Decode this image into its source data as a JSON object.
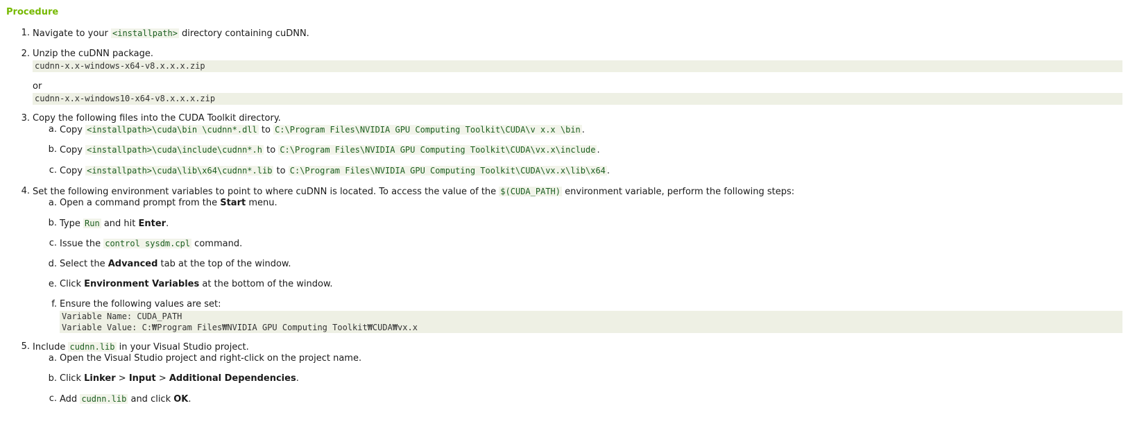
{
  "title": "Procedure",
  "steps": {
    "s1": {
      "num": "1.",
      "pre": "Navigate to your ",
      "code": "<installpath>",
      "post": " directory containing cuDNN."
    },
    "s2": {
      "num": "2.",
      "text": "Unzip the cuDNN package.",
      "block1": "cudnn-x.x-windows-x64-v8.x.x.x.zip",
      "or": "or",
      "block2": "cudnn-x.x-windows10-x64-v8.x.x.x.zip"
    },
    "s3": {
      "num": "3.",
      "text": "Copy the following files into the CUDA Toolkit directory.",
      "a": {
        "num": "a.",
        "pre": "Copy ",
        "code1": "<installpath>\\cuda\\bin \\cudnn*.dll",
        "mid": " to ",
        "code2": "C:\\Program Files\\NVIDIA GPU Computing Toolkit\\CUDA\\v x.x \\bin",
        "post": "."
      },
      "b": {
        "num": "b.",
        "pre": "Copy ",
        "code1": "<installpath>\\cuda\\include\\cudnn*.h",
        "mid": " to ",
        "code2": "C:\\Program Files\\NVIDIA GPU Computing Toolkit\\CUDA\\vx.x\\include",
        "post": "."
      },
      "c": {
        "num": "c.",
        "pre": "Copy ",
        "code1": "<installpath>\\cuda\\lib\\x64\\cudnn*.lib",
        "mid": " to ",
        "code2": "C:\\Program Files\\NVIDIA GPU Computing Toolkit\\CUDA\\vx.x\\lib\\x64",
        "post": "."
      }
    },
    "s4": {
      "num": "4.",
      "pre": "Set the following environment variables to point to where cuDNN is located. To access the value of the ",
      "code": "$(CUDA_PATH)",
      "post": " environment variable, perform the following steps:",
      "a": {
        "num": "a.",
        "pre": "Open a command prompt from the ",
        "bold": "Start",
        "post": " menu."
      },
      "b": {
        "num": "b.",
        "pre": "Type ",
        "code": "Run",
        "mid": " and hit ",
        "bold": "Enter",
        "post": "."
      },
      "c": {
        "num": "c.",
        "pre": "Issue the ",
        "code": "control sysdm.cpl",
        "post": " command."
      },
      "d": {
        "num": "d.",
        "pre": "Select the ",
        "bold": "Advanced",
        "post": " tab at the top of the window."
      },
      "e": {
        "num": "e.",
        "pre": "Click ",
        "bold": "Environment Variables",
        "post": " at the bottom of the window."
      },
      "f": {
        "num": "f.",
        "text": "Ensure the following values are set:",
        "line1": "Variable Name: CUDA_PATH",
        "line2": "Variable Value: C:₩Program Files₩NVIDIA GPU Computing Toolkit₩CUDA₩vx.x"
      }
    },
    "s5": {
      "num": "5.",
      "pre": "Include ",
      "code": "cudnn.lib",
      "post": " in your Visual Studio project.",
      "a": {
        "num": "a.",
        "text": "Open the Visual Studio project and right-click on the project name."
      },
      "b": {
        "num": "b.",
        "pre": "Click ",
        "bold1": "Linker",
        "sep1": " > ",
        "bold2": "Input",
        "sep2": " > ",
        "bold3": "Additional Dependencies",
        "post": "."
      },
      "c": {
        "num": "c.",
        "pre": "Add ",
        "code": "cudnn.lib",
        "mid": " and click ",
        "bold": "OK",
        "post": "."
      }
    }
  }
}
